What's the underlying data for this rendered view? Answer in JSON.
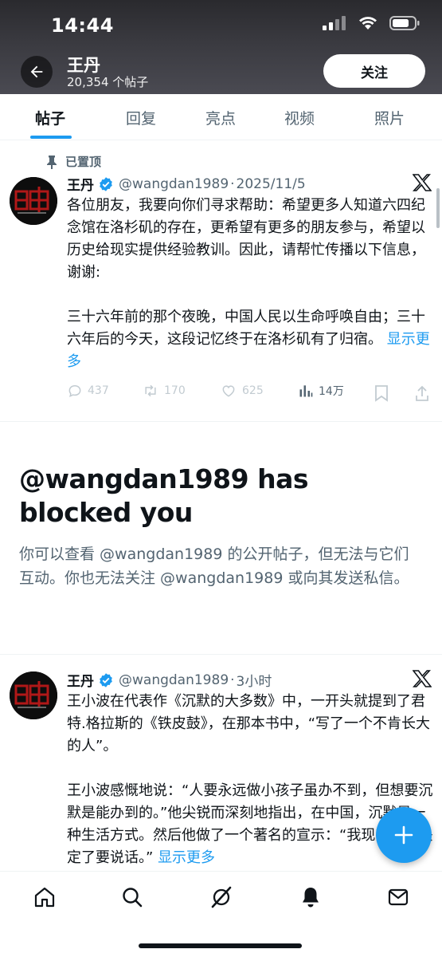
{
  "status_bar": {
    "time": "14:44"
  },
  "profile": {
    "name": "王丹",
    "post_count": "20,354 个帖子",
    "follow_label": "关注"
  },
  "tabs": [
    {
      "label": "帖子",
      "active": true
    },
    {
      "label": "回复",
      "active": false
    },
    {
      "label": "亮点",
      "active": false
    },
    {
      "label": "视频",
      "active": false
    },
    {
      "label": "照片",
      "active": false
    }
  ],
  "pinned_label": "已置顶",
  "tweets": [
    {
      "name": "王丹",
      "handle": "@wangdan1989",
      "separator": "·",
      "time": "2025/11/5",
      "paragraphs": [
        "各位朋友，我要向你们寻求帮助：希望更多人知道六四纪念馆在洛杉矶的存在，更希望有更多的朋友参与，希望以历史给现实提供经验教训。因此，请帮忙传播以下信息，谢谢:",
        "三十六年前的那个夜晚，中国人民以生命呼唤自由；三十六年后的今天，这段记忆终于在洛杉矶有了归宿。"
      ],
      "show_more": "显示更多",
      "stats": {
        "replies": "437",
        "reposts": "170",
        "likes": "625",
        "views": "14万"
      }
    },
    {
      "name": "王丹",
      "handle": "@wangdan1989",
      "separator": "·",
      "time": "3小时",
      "paragraphs": [
        "王小波在代表作《沉默的大多数》中，一开头就提到了君特.格拉斯的《铁皮鼓》，在那本书中，“写了一个不肯长大的人”。",
        "王小波感慨地说：“人要永远做小孩子虽办不到，但想要沉默是能办到的。”他尖锐而深刻地指出，在中国，沉默是一种生活方式。然后他做了一个著名的宣示：“我现在已经决定了要说话。”"
      ],
      "show_more": "显示更多"
    }
  ],
  "blocked": {
    "title": "@wangdan1989 has blocked you",
    "description": "你可以查看 @wangdan1989 的公开帖子，但无法与它们互动。你也无法关注 @wangdan1989 或向其发送私信。"
  },
  "icons": {
    "back": "arrow-left-icon",
    "verified": "verified-badge-icon",
    "x_logo": "x-logo-icon",
    "pin": "pin-icon",
    "compose": "plus-icon",
    "nav": [
      "home-icon",
      "search-icon",
      "grok-icon",
      "bell-icon",
      "mail-icon"
    ]
  },
  "colors": {
    "accent": "#1d9bf0",
    "text": "#0f1419",
    "secondary": "#536471"
  }
}
